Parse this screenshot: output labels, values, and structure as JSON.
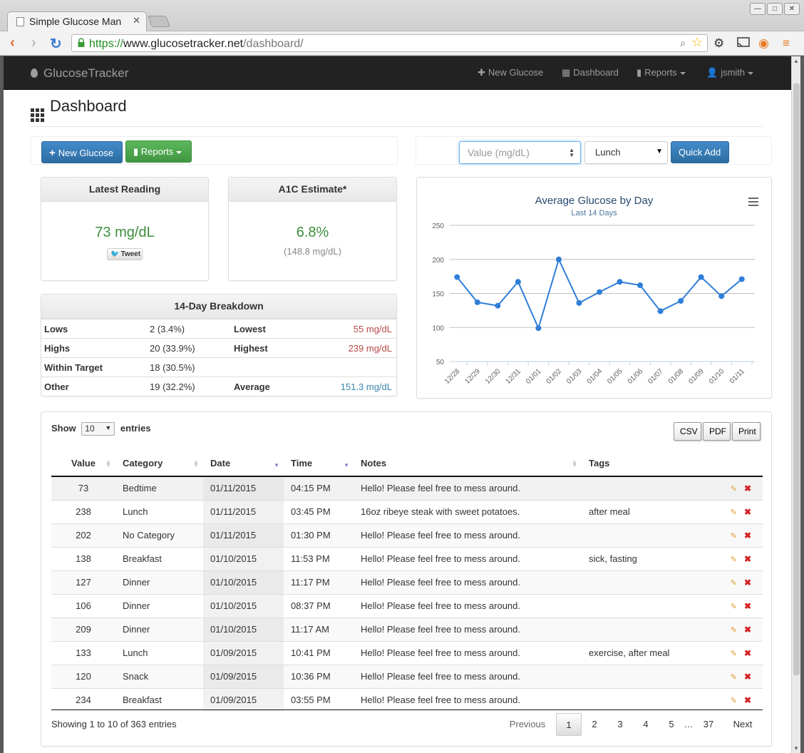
{
  "browser": {
    "tab_title": "Simple Glucose Man",
    "url_protocol": "https://",
    "url_host": "www.glucosetracker.net",
    "url_path": "/dashboard/"
  },
  "navbar": {
    "brand": "GlucoseTracker",
    "links": {
      "new_glucose": "New Glucose",
      "dashboard": "Dashboard",
      "reports": "Reports",
      "user": "jsmith"
    }
  },
  "page_title": "Dashboard",
  "toolbar": {
    "new_glucose": "New Glucose",
    "reports": "Reports"
  },
  "quick_add": {
    "value_placeholder": "Value (mg/dL)",
    "category_selected": "Lunch",
    "button": "Quick Add"
  },
  "latest_reading": {
    "title": "Latest Reading",
    "value": "73 mg/dL",
    "tweet_label": "Tweet"
  },
  "a1c": {
    "title": "A1C Estimate*",
    "value": "6.8%",
    "sub": "(148.8 mg/dL)"
  },
  "breakdown": {
    "title": "14-Day Breakdown",
    "rows": [
      {
        "label": "Lows",
        "value": "2 (3.4%)",
        "label2": "Lowest",
        "value2": "55 mg/dL"
      },
      {
        "label": "Highs",
        "value": "20 (33.9%)",
        "label2": "Highest",
        "value2": "239 mg/dL"
      },
      {
        "label": "Within Target",
        "value": "18 (30.5%)",
        "label2": "",
        "value2": ""
      },
      {
        "label": "Other",
        "value": "19 (32.2%)",
        "label2": "Average",
        "value2": "151.3 mg/dL"
      }
    ]
  },
  "chart_data": {
    "type": "line",
    "title": "Average Glucose by Day",
    "subtitle": "Last 14 Days",
    "categories": [
      "12/28",
      "12/29",
      "12/30",
      "12/31",
      "01/01",
      "01/02",
      "01/03",
      "01/04",
      "01/05",
      "01/06",
      "01/07",
      "01/08",
      "01/09",
      "01/10",
      "01/11"
    ],
    "series": [
      {
        "values": [
          174,
          137,
          132,
          167,
          99,
          200,
          136,
          152,
          167,
          162,
          124,
          139,
          174,
          146,
          171
        ]
      }
    ],
    "yticks": [
      50,
      100,
      150,
      200,
      250
    ],
    "ylim": [
      50,
      250
    ],
    "color": "#2f7ed8",
    "grid": true
  },
  "table": {
    "length_label_before": "Show",
    "length_value": "10",
    "length_label_after": "entries",
    "export_buttons": [
      "CSV",
      "PDF",
      "Print"
    ],
    "columns": [
      "Value",
      "Category",
      "Date",
      "Time",
      "Notes",
      "Tags"
    ],
    "rows": [
      {
        "value": "73",
        "level": "low",
        "category": "Bedtime",
        "date": "01/11/2015",
        "time": "04:15 PM",
        "notes": "Hello! Please feel free to mess around.",
        "tags": ""
      },
      {
        "value": "238",
        "level": "high",
        "category": "Lunch",
        "date": "01/11/2015",
        "time": "03:45 PM",
        "notes": "16oz ribeye steak with sweet potatoes.",
        "tags": "after meal"
      },
      {
        "value": "202",
        "level": "high",
        "category": "No Category",
        "date": "01/11/2015",
        "time": "01:30 PM",
        "notes": "Hello! Please feel free to mess around.",
        "tags": ""
      },
      {
        "value": "138",
        "level": "mid",
        "category": "Breakfast",
        "date": "01/10/2015",
        "time": "11:53 PM",
        "notes": "Hello! Please feel free to mess around.",
        "tags": "sick, fasting"
      },
      {
        "value": "127",
        "level": "mid",
        "category": "Dinner",
        "date": "01/10/2015",
        "time": "11:17 PM",
        "notes": "Hello! Please feel free to mess around.",
        "tags": ""
      },
      {
        "value": "106",
        "level": "low",
        "category": "Dinner",
        "date": "01/10/2015",
        "time": "08:37 PM",
        "notes": "Hello! Please feel free to mess around.",
        "tags": ""
      },
      {
        "value": "209",
        "level": "high",
        "category": "Dinner",
        "date": "01/10/2015",
        "time": "11:17 AM",
        "notes": "Hello! Please feel free to mess around.",
        "tags": ""
      },
      {
        "value": "133",
        "level": "mid",
        "category": "Lunch",
        "date": "01/09/2015",
        "time": "10:41 PM",
        "notes": "Hello! Please feel free to mess around.",
        "tags": "exercise, after meal"
      },
      {
        "value": "120",
        "level": "low",
        "category": "Snack",
        "date": "01/09/2015",
        "time": "10:36 PM",
        "notes": "Hello! Please feel free to mess around.",
        "tags": ""
      },
      {
        "value": "234",
        "level": "high",
        "category": "Breakfast",
        "date": "01/09/2015",
        "time": "03:55 PM",
        "notes": "Hello! Please feel free to mess around.",
        "tags": ""
      }
    ],
    "info": "Showing 1 to 10 of 363 entries",
    "pagination": {
      "previous": "Previous",
      "pages": [
        "1",
        "2",
        "3",
        "4",
        "5"
      ],
      "ellipsis": "…",
      "last": "37",
      "next": "Next",
      "current": "1"
    }
  },
  "colors": {
    "low": "#1a8a1a",
    "high": "#c0282a",
    "mid": "#3a87ad",
    "primary": "#428bca",
    "success": "#5cb85c"
  }
}
